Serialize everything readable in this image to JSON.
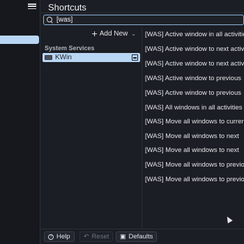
{
  "header": {
    "title": "Shortcuts"
  },
  "search": {
    "value": "[was]"
  },
  "left_pane": {
    "add_new_label": "Add New",
    "group_label": "System Services",
    "selected_item": "KWin"
  },
  "shortcuts": [
    "[WAS] Active window in all activities",
    "[WAS] Active window to next activity",
    "[WAS] Active window to next activity",
    "[WAS] Active window to previous",
    "[WAS] Active window to previous",
    "[WAS] All windows in all activities",
    "[WAS] Move all windows to current",
    "[WAS] Move all windows to next",
    "[WAS] Move all windows to next",
    "[WAS] Move all windows to previous",
    "[WAS] Move all windows to previous"
  ],
  "footer": {
    "help_label": "Help",
    "reset_label": "Reset",
    "defaults_label": "Defaults"
  },
  "colors": {
    "accent": "#b9d6f5",
    "background": "#1b1e24"
  }
}
